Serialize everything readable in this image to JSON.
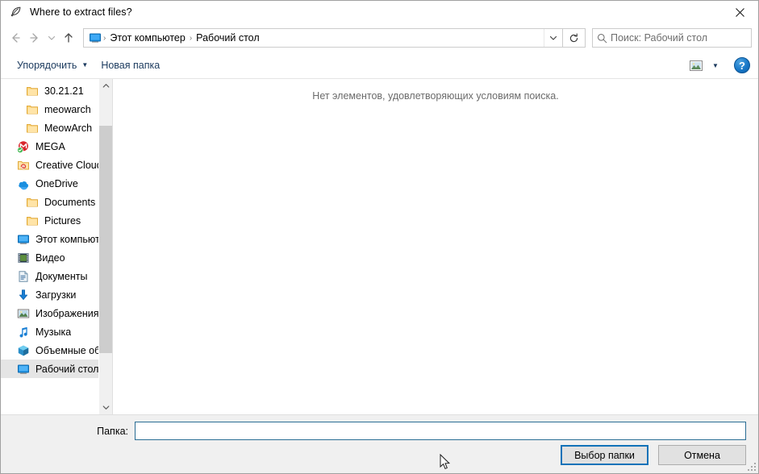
{
  "window": {
    "title": "Where to extract files?",
    "title_icon": "feather-quill-icon",
    "close_label": "✕"
  },
  "nav": {
    "back_icon": "arrow-left-icon",
    "forward_icon": "arrow-right-icon",
    "recent_icon": "chevron-down-icon",
    "up_icon": "arrow-up-icon",
    "address_icon": "this-pc-monitor-icon",
    "breadcrumbs": [
      "Этот компьютер",
      "Рабочий стол"
    ],
    "separator": "›",
    "dropdown_icon": "chevron-down-icon",
    "refresh_icon": "refresh-icon"
  },
  "search": {
    "icon": "search-icon",
    "placeholder": "Поиск: Рабочий стол",
    "value": ""
  },
  "toolbar": {
    "organize_label": "Упорядочить",
    "organize_caret": "▼",
    "new_folder_label": "Новая папка",
    "view_icon": "view-mode-icon",
    "view_caret": "▼",
    "help_label": "?"
  },
  "sidebar": {
    "items": [
      {
        "label": "30.21.21",
        "icon": "folder-icon",
        "indent": true,
        "selected": false
      },
      {
        "label": "meowarch",
        "icon": "folder-icon",
        "indent": true,
        "selected": false
      },
      {
        "label": "MeowArch",
        "icon": "folder-icon",
        "indent": true,
        "selected": false
      },
      {
        "label": "MEGA",
        "icon": "mega-icon",
        "indent": false,
        "selected": false
      },
      {
        "label": "Creative Cloud Fil",
        "icon": "creative-cloud-folder-icon",
        "indent": false,
        "selected": false
      },
      {
        "label": "OneDrive",
        "icon": "onedrive-cloud-icon",
        "indent": false,
        "selected": false
      },
      {
        "label": "Documents",
        "icon": "folder-icon",
        "indent": true,
        "selected": false
      },
      {
        "label": "Pictures",
        "icon": "folder-icon",
        "indent": true,
        "selected": false
      },
      {
        "label": "Этот компьютер",
        "icon": "this-pc-monitor-icon",
        "indent": false,
        "selected": false
      },
      {
        "label": "Видео",
        "icon": "videos-film-icon",
        "indent": false,
        "selected": false
      },
      {
        "label": "Документы",
        "icon": "documents-icon",
        "indent": false,
        "selected": false
      },
      {
        "label": "Загрузки",
        "icon": "downloads-arrow-icon",
        "indent": false,
        "selected": false
      },
      {
        "label": "Изображения",
        "icon": "pictures-image-icon",
        "indent": false,
        "selected": false
      },
      {
        "label": "Музыка",
        "icon": "music-note-icon",
        "indent": false,
        "selected": false
      },
      {
        "label": "Объемные объ",
        "icon": "3d-objects-cube-icon",
        "indent": false,
        "selected": false
      },
      {
        "label": "Рабочий стол",
        "icon": "desktop-monitor-icon",
        "indent": false,
        "selected": true
      }
    ],
    "scroll_up_icon": "chevron-up-icon",
    "scroll_down_icon": "chevron-down-icon"
  },
  "content": {
    "empty_message": "Нет элементов, удовлетворяющих условиям поиска."
  },
  "bottom": {
    "folder_label": "Папка:",
    "folder_value": "",
    "select_button": "Выбор папки",
    "cancel_button": "Отмена"
  },
  "colors": {
    "accent": "#1172b8",
    "folder_yellow": "#ffd67a",
    "onedrive_blue": "#1a8fe0",
    "mega_red": "#d9272e",
    "selection_gray": "#e5e5e5",
    "panel_gray": "#f0f0f0"
  }
}
